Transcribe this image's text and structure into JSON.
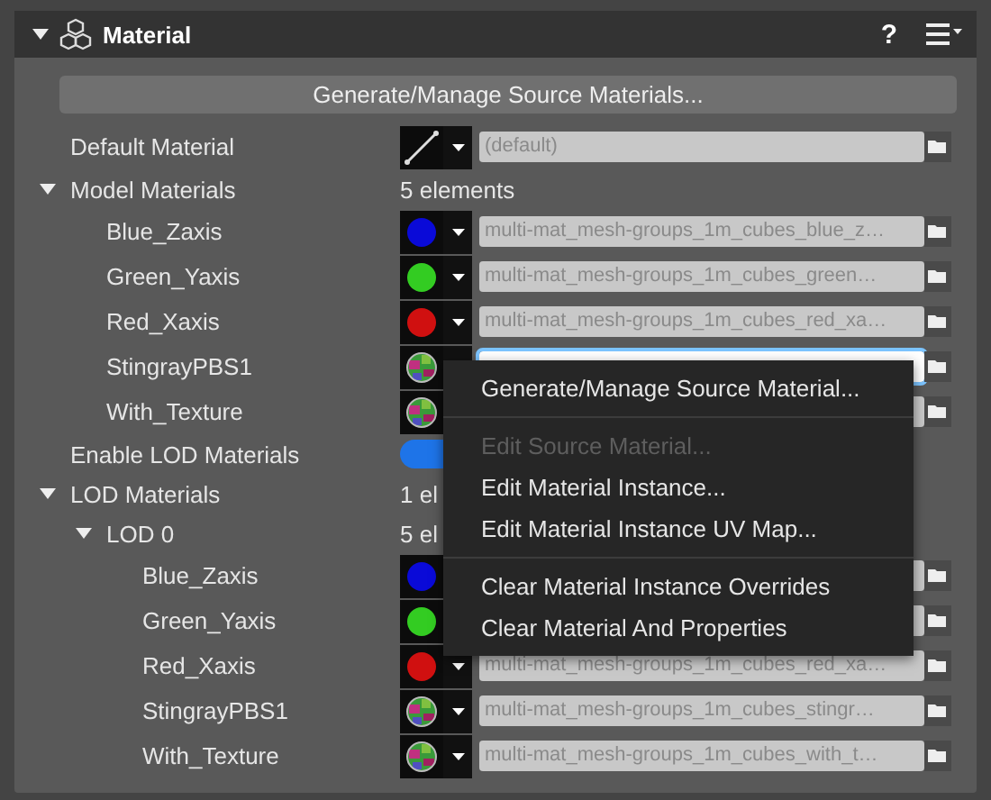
{
  "header": {
    "title": "Material",
    "expanded": true,
    "help": "?"
  },
  "generate_button": "Generate/Manage Source Materials...",
  "properties": [
    {
      "kind": "material",
      "label": "Default Material",
      "swatch": {
        "kind": "line"
      },
      "value": "(default)",
      "focused": false
    },
    {
      "kind": "group",
      "label": "Model Materials",
      "expanded": true,
      "summary": "5 elements",
      "children": [
        {
          "kind": "material",
          "label": "Blue_Zaxis",
          "swatch": {
            "kind": "sphere",
            "color": "#0a0ad8"
          },
          "value": "multi-mat_mesh-groups_1m_cubes_blue_z…",
          "focused": false
        },
        {
          "kind": "material",
          "label": "Green_Yaxis",
          "swatch": {
            "kind": "sphere",
            "color": "#33cc22"
          },
          "value": "multi-mat_mesh-groups_1m_cubes_green…",
          "focused": false
        },
        {
          "kind": "material",
          "label": "Red_Xaxis",
          "swatch": {
            "kind": "sphere",
            "color": "#d01010"
          },
          "value": "multi-mat_mesh-groups_1m_cubes_red_xa…",
          "focused": false
        },
        {
          "kind": "material",
          "label": "StingrayPBS1",
          "swatch": {
            "kind": "texture"
          },
          "focused": true
        },
        {
          "kind": "material",
          "label": "With_Texture",
          "swatch": {
            "kind": "texture"
          },
          "focused": false
        }
      ]
    },
    {
      "kind": "toggle",
      "label": "Enable LOD Materials",
      "on": true
    },
    {
      "kind": "group",
      "label": "LOD Materials",
      "expanded": true,
      "summary": "1 el",
      "children": [
        {
          "kind": "group",
          "label": "LOD 0",
          "expanded": true,
          "summary": "5 el",
          "children": [
            {
              "kind": "material",
              "label": "Blue_Zaxis",
              "swatch": {
                "kind": "sphere",
                "color": "#0a0ad8"
              },
              "focused": false
            },
            {
              "kind": "material",
              "label": "Green_Yaxis",
              "swatch": {
                "kind": "sphere",
                "color": "#33cc22"
              },
              "focused": false
            },
            {
              "kind": "material",
              "label": "Red_Xaxis",
              "swatch": {
                "kind": "sphere",
                "color": "#d01010"
              },
              "value": "multi-mat_mesh-groups_1m_cubes_red_xa…",
              "focused": false
            },
            {
              "kind": "material",
              "label": "StingrayPBS1",
              "swatch": {
                "kind": "texture"
              },
              "value": "multi-mat_mesh-groups_1m_cubes_stingr…",
              "focused": false
            },
            {
              "kind": "material",
              "label": "With_Texture",
              "swatch": {
                "kind": "texture"
              },
              "value": "multi-mat_mesh-groups_1m_cubes_with_t…",
              "focused": false
            }
          ]
        }
      ]
    }
  ],
  "context_menu": [
    {
      "label": "Generate/Manage Source Material...",
      "disabled": false,
      "separator_after": true
    },
    {
      "label": "Edit Source Material...",
      "disabled": true,
      "separator_after": false
    },
    {
      "label": "Edit Material Instance...",
      "disabled": false,
      "separator_after": false
    },
    {
      "label": "Edit Material Instance UV Map...",
      "disabled": false,
      "separator_after": true
    },
    {
      "label": "Clear Material Instance Overrides",
      "disabled": false,
      "separator_after": false
    },
    {
      "label": "Clear Material And Properties",
      "disabled": false,
      "separator_after": false
    }
  ]
}
